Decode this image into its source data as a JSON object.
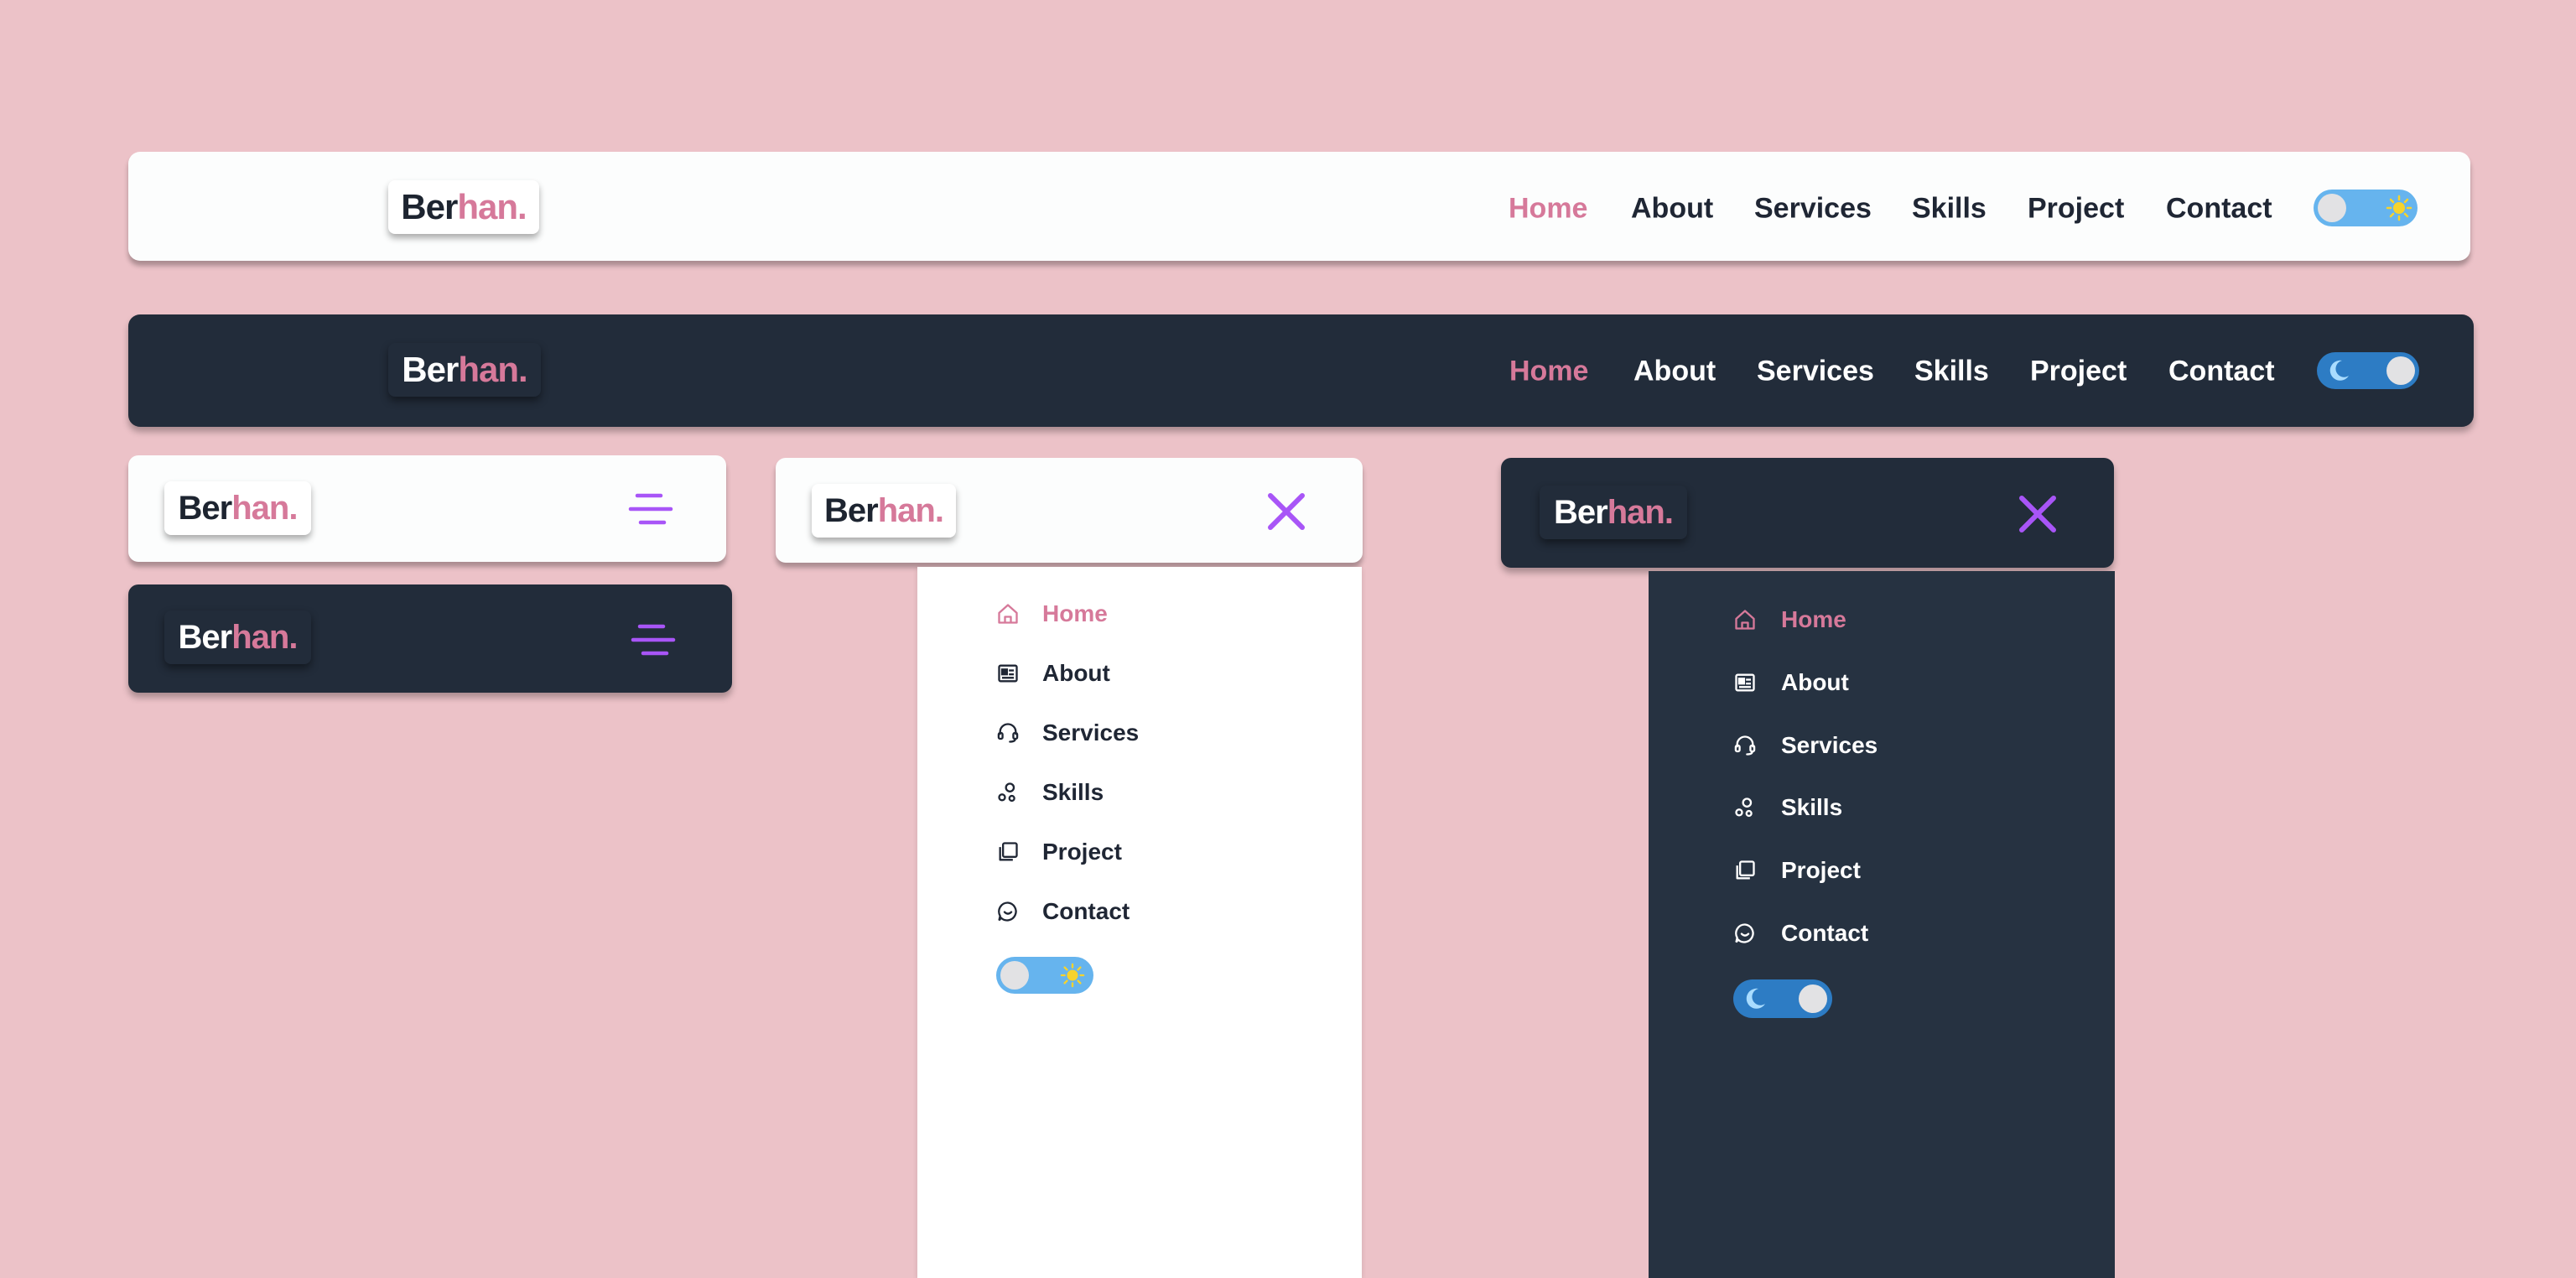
{
  "brand": {
    "prefix": "Ber",
    "accent": "han."
  },
  "nav": {
    "links": [
      "Home",
      "About",
      "Services",
      "Skills",
      "Project",
      "Contact"
    ],
    "active": "Home"
  },
  "menu_icons": [
    "home-icon",
    "about-card-icon",
    "services-headset-icon",
    "skills-icon",
    "project-icon",
    "contact-chat-icon"
  ],
  "theme": {
    "light_toggle_icon": "sun-icon",
    "dark_toggle_icon": "moon-icon"
  },
  "colors": {
    "background": "#ecc2c8",
    "light_bar": "#fcfdfd",
    "dark_bar": "#222c3a",
    "dark_panel": "#263241",
    "accent_pink": "#d6799a",
    "menu_purple": "#a855f7",
    "text_dark": "#1f2634",
    "toggle_light": "#66b4ee",
    "toggle_dark": "#2d7cc4",
    "sun": "#f6d32d"
  }
}
